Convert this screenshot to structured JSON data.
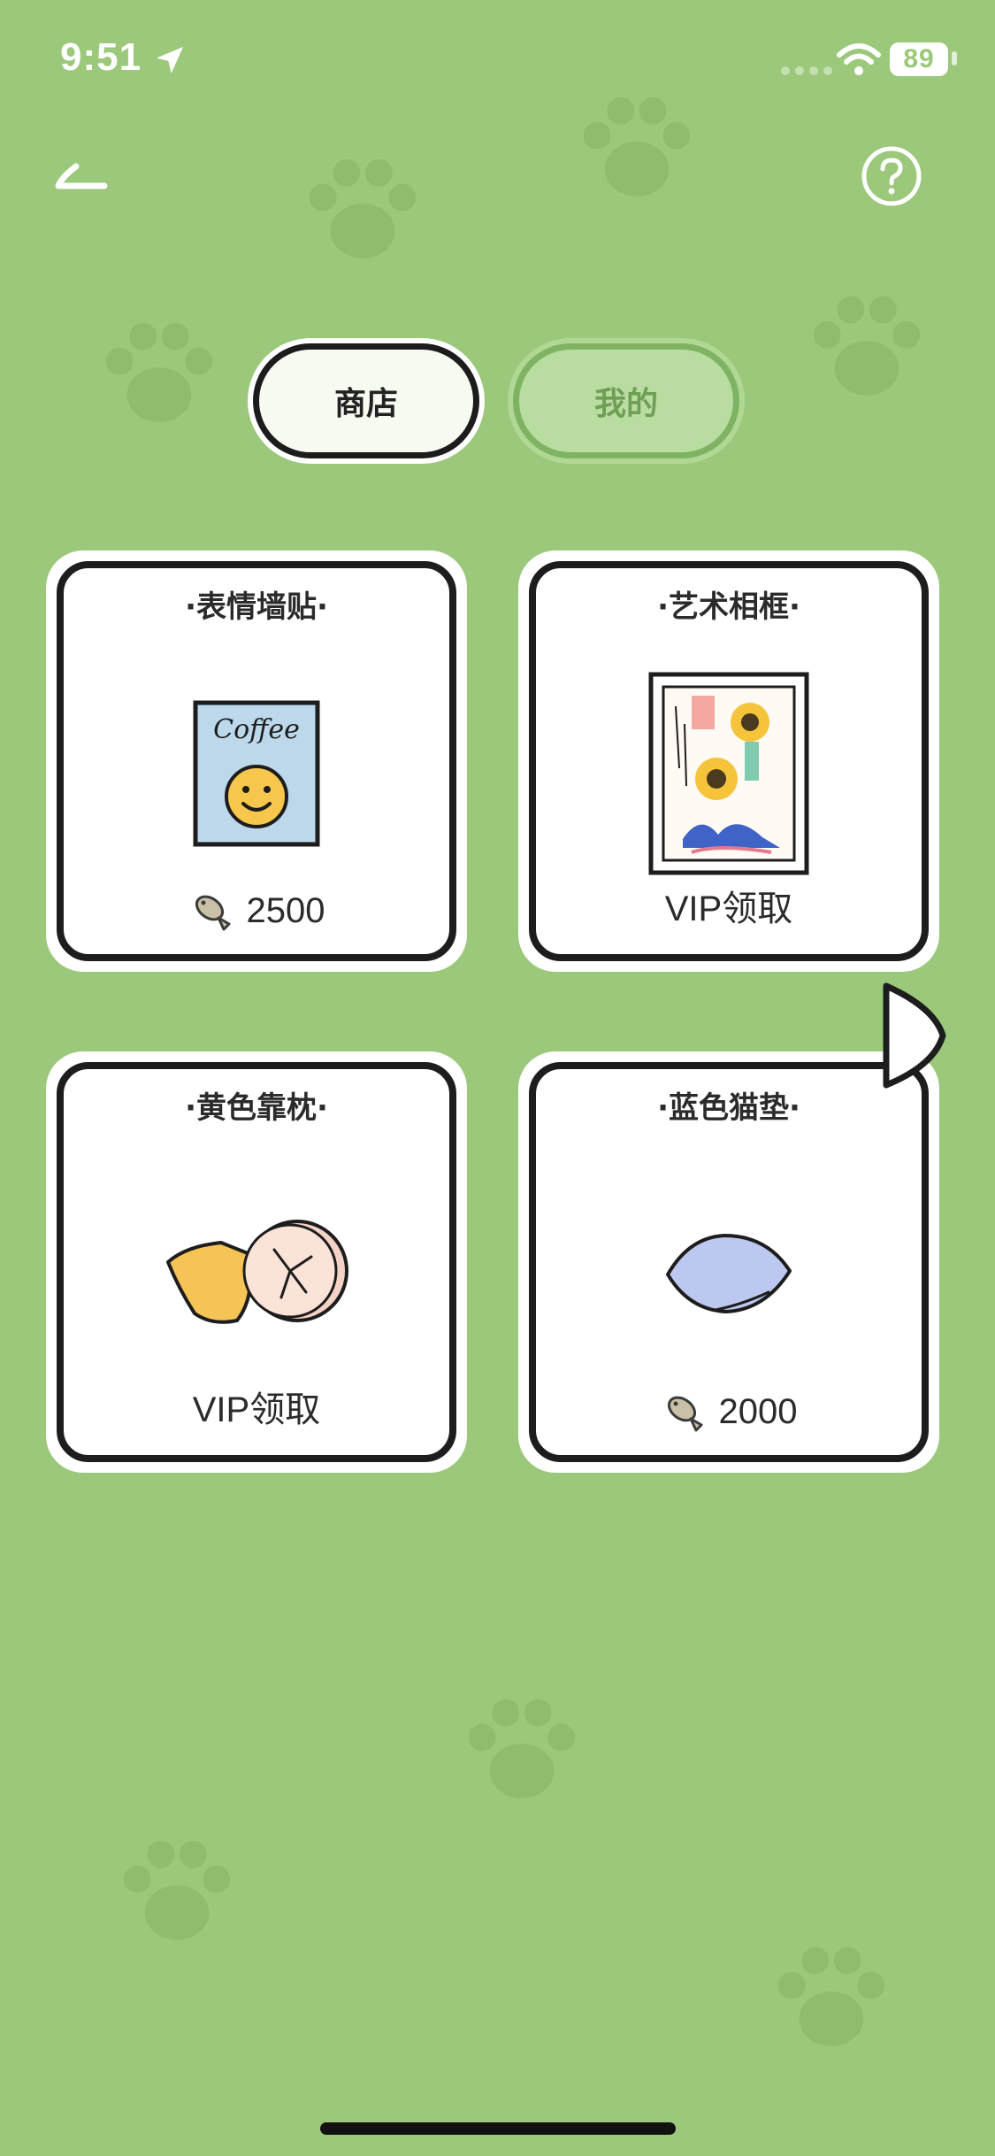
{
  "status_bar": {
    "time": "9:51",
    "battery": "89"
  },
  "tabs": [
    {
      "label": "商店",
      "active": true
    },
    {
      "label": "我的",
      "active": false
    }
  ],
  "items": [
    {
      "title": "·表情墙贴·",
      "price": "2500",
      "icon": "emoji-poster-icon"
    },
    {
      "title": "·艺术相框·",
      "price": "VIP领取",
      "icon": "art-frame-icon"
    },
    {
      "title": "·黄色靠枕·",
      "price": "VIP领取",
      "icon": "pillow-icon"
    },
    {
      "title": "·蓝色猫垫·",
      "price": "2000",
      "icon": "cat-cushion-icon"
    }
  ],
  "poster_text": "Coffee",
  "colors": {
    "background": "#9bc87a",
    "paw": "#8fc06c",
    "card_border": "#1d1d1d"
  }
}
